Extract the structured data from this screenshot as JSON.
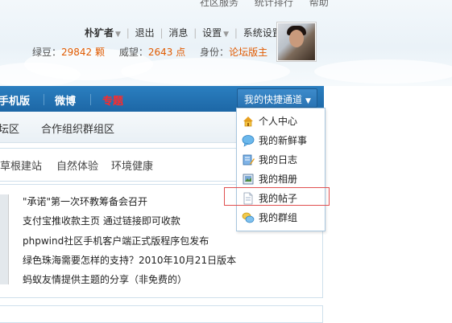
{
  "topbar": {
    "links": [
      "社区服务",
      "统计排行",
      "帮助"
    ]
  },
  "user": {
    "name": "朴犷者",
    "logout": "退出",
    "messages": "消息",
    "settings": "设置",
    "system_settings": "系统设置",
    "stats": {
      "green_bean_label": "绿豆：",
      "green_bean_value": "29842 颗",
      "prestige_label": "威望：",
      "prestige_value": "2643 点",
      "role_label": "身份：",
      "role_value": "论坛版主"
    }
  },
  "nav": {
    "items": [
      {
        "label": "手机版"
      },
      {
        "label": "微博"
      },
      {
        "label": "专题"
      }
    ],
    "quick_access": "我的快捷通道"
  },
  "subnav": {
    "items": [
      "坛区",
      "合作组织群组区"
    ]
  },
  "panel1": {
    "items": [
      "草根建站",
      "自然体验",
      "环境健康"
    ]
  },
  "news": {
    "items": [
      "\"承诺\"第一次环教筹备会召开",
      "支付宝推收款主页 通过链接即可收款",
      "phpwind社区手机客户端正式版程序包发布",
      "绿色珠海需要怎样的支持？2010年10月21日版本",
      "蚂蚁友情提供主题的分享（非免费的）"
    ]
  },
  "dropdown": {
    "items": [
      {
        "label": "个人中心",
        "icon": "home-icon"
      },
      {
        "label": "我的新鲜事",
        "icon": "speech-bubble-icon"
      },
      {
        "label": "我的日志",
        "icon": "notebook-pen-icon"
      },
      {
        "label": "我的相册",
        "icon": "photo-album-icon"
      },
      {
        "label": "我的帖子",
        "icon": "document-icon"
      },
      {
        "label": "我的群组",
        "icon": "group-chat-icon"
      }
    ]
  },
  "colors": {
    "nav_blue": "#1d67a6",
    "accent_orange": "#e05a00",
    "red_label": "#ff2a2a",
    "highlight_red": "#e05050"
  }
}
